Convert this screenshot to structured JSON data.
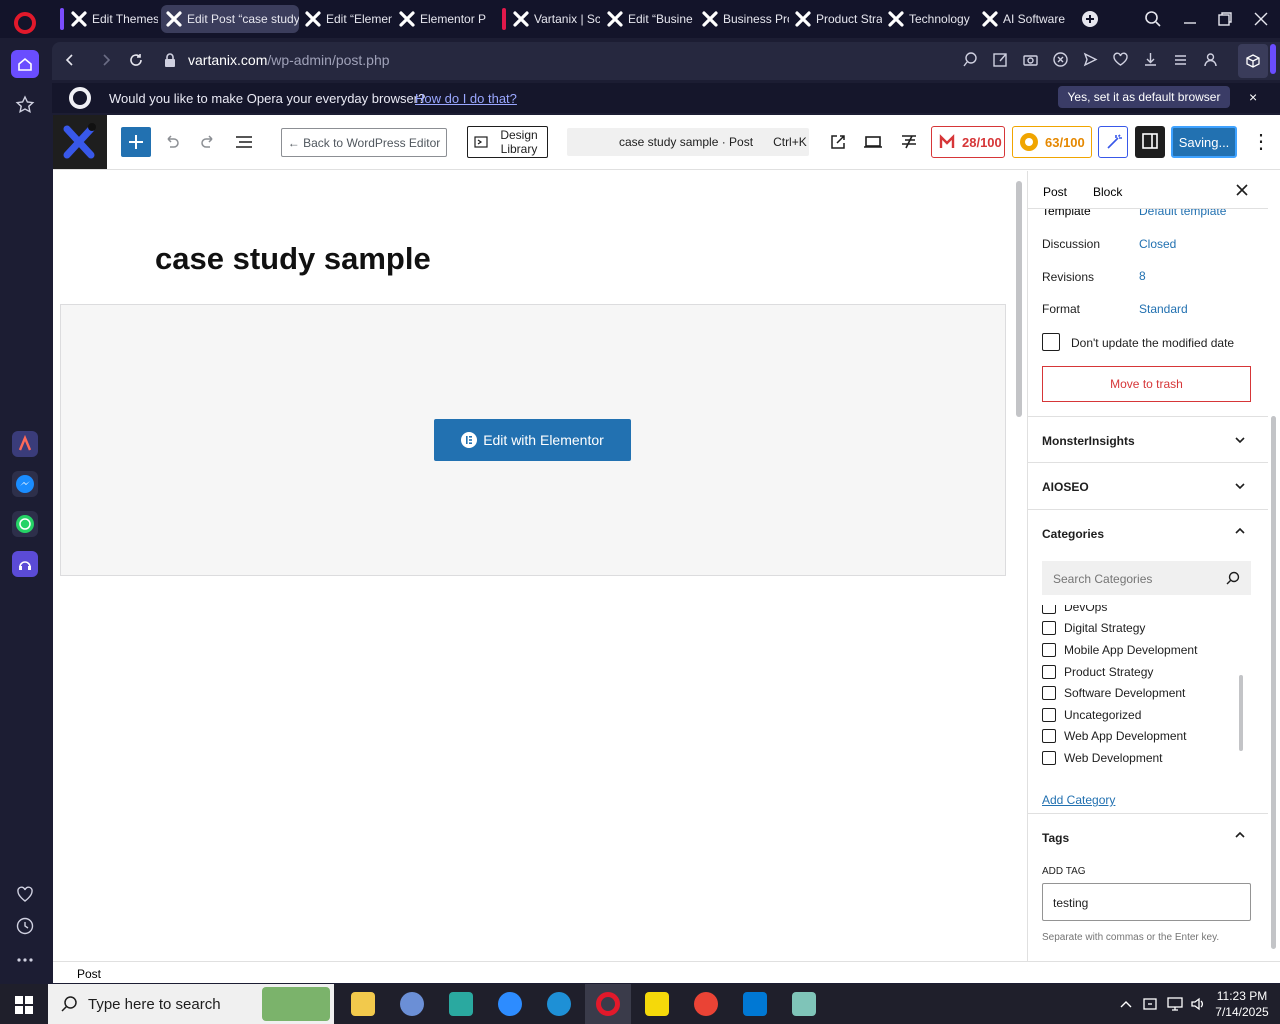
{
  "tabs": [
    {
      "label": "Edit Themes"
    },
    {
      "label": "Edit Post “case study"
    },
    {
      "label": "Edit “Elemen"
    },
    {
      "label": "Elementor P"
    },
    {
      "label": "Vartanix | Sc"
    },
    {
      "label": "Edit “Busine"
    },
    {
      "label": "Business Pro"
    },
    {
      "label": "Product Stra"
    },
    {
      "label": "Technology"
    },
    {
      "label": "AI Software"
    }
  ],
  "address": {
    "domain": "vartanix.com",
    "path": "/wp-admin/post.php"
  },
  "notification": {
    "text": "Would you like to make Opera your everyday browser?",
    "link": "How do I do that?",
    "button": "Yes, set it as default browser",
    "close": "×"
  },
  "toolbar": {
    "back_label": "← Back to WordPress Editor",
    "design_library": "Design Library",
    "command_title": "case study sample · Post",
    "command_shortcut": "Ctrl+K",
    "score1": "28/100",
    "score2": "63/100",
    "saving": "Saving...",
    "more": "⋮"
  },
  "editor": {
    "post_title": "case study sample",
    "elementor_button": "Edit with Elementor"
  },
  "sidebar": {
    "tab_post": "Post",
    "tab_block": "Block",
    "template_label": "Template",
    "template_value": "Default template",
    "discussion_label": "Discussion",
    "discussion_value": "Closed",
    "revisions_label": "Revisions",
    "revisions_value": "8",
    "format_label": "Format",
    "format_value": "Standard",
    "dont_update": "Don't update the modified date",
    "trash": "Move to trash",
    "monsterinsights": "MonsterInsights",
    "aioseo": "AIOSEO",
    "categories": "Categories",
    "search_categories": "Search Categories",
    "category_items": [
      "DevOps",
      "Digital Strategy",
      "Mobile App Development",
      "Product Strategy",
      "Software Development",
      "Uncategorized",
      "Web App Development",
      "Web Development"
    ],
    "add_category": "Add Category",
    "tags": "Tags",
    "add_tag": "ADD TAG",
    "tag_value": "testing",
    "tag_help": "Separate with commas or the Enter key."
  },
  "statusbar": {
    "label": "Post"
  },
  "taskbar": {
    "search_placeholder": "Type here to search",
    "time": "11:23 PM",
    "date": "7/14/2025"
  },
  "colors": {
    "wp_blue": "#2271b1",
    "saving_blue": "#3858e9",
    "score_red": "#d63638",
    "score_orange": "#f0a500"
  }
}
